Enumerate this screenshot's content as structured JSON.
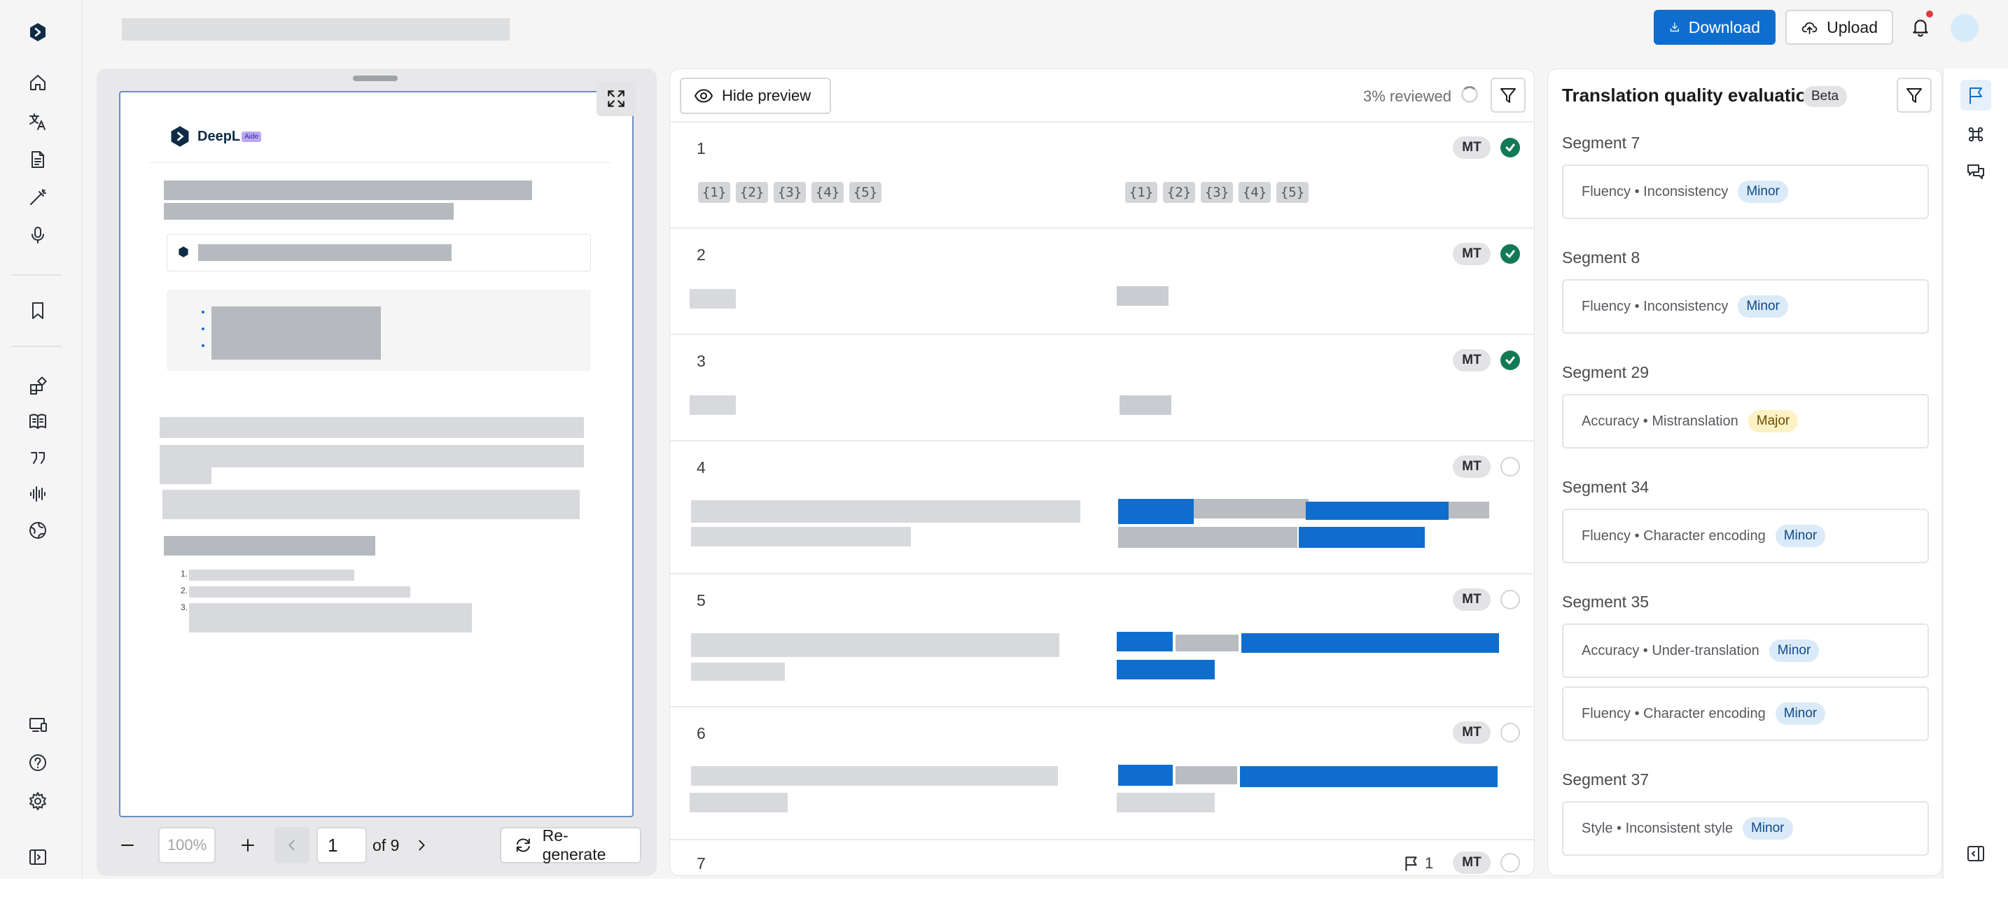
{
  "header": {
    "download_label": "Download",
    "upload_label": "Upload"
  },
  "preview": {
    "hide_label": "Hide preview",
    "logo_text": "DeepL",
    "logo_badge": "Aide",
    "zoom_value": "100%",
    "page_value": "1",
    "page_total": "of 9",
    "regenerate_label": "Re-generate",
    "list_markers": [
      "1.",
      "2.",
      "3."
    ]
  },
  "segments": {
    "reviewed_text": "3% reviewed",
    "mt_label": "MT",
    "tags": [
      "{1}",
      "{2}",
      "{3}",
      "{4}",
      "{5}"
    ],
    "rows": [
      {
        "num": "1",
        "status": "done"
      },
      {
        "num": "2",
        "status": "done"
      },
      {
        "num": "3",
        "status": "done"
      },
      {
        "num": "4",
        "status": "open"
      },
      {
        "num": "5",
        "status": "open"
      },
      {
        "num": "6",
        "status": "open"
      },
      {
        "num": "7",
        "status": "open",
        "flags": "1"
      }
    ]
  },
  "quality": {
    "title": "Translation quality evaluation",
    "beta_label": "Beta",
    "groups": [
      {
        "title": "Segment 7",
        "issues": [
          {
            "text": "Fluency • Inconsistency",
            "severity": "Minor"
          }
        ]
      },
      {
        "title": "Segment 8",
        "issues": [
          {
            "text": "Fluency • Inconsistency",
            "severity": "Minor"
          }
        ]
      },
      {
        "title": "Segment 29",
        "issues": [
          {
            "text": "Accuracy • Mistranslation",
            "severity": "Major"
          }
        ]
      },
      {
        "title": "Segment 34",
        "issues": [
          {
            "text": "Fluency • Character encoding",
            "severity": "Minor"
          }
        ]
      },
      {
        "title": "Segment 35",
        "issues": [
          {
            "text": "Accuracy • Under-translation",
            "severity": "Minor"
          },
          {
            "text": "Fluency • Character encoding",
            "severity": "Minor"
          }
        ]
      },
      {
        "title": "Segment 37",
        "issues": [
          {
            "text": "Style • Inconsistent style",
            "severity": "Minor"
          }
        ]
      }
    ]
  },
  "colors": {
    "accent": "#0f6ecd",
    "success": "#117a55",
    "minor_bg": "#dbeaf8",
    "major_bg": "#fdf2c4"
  }
}
